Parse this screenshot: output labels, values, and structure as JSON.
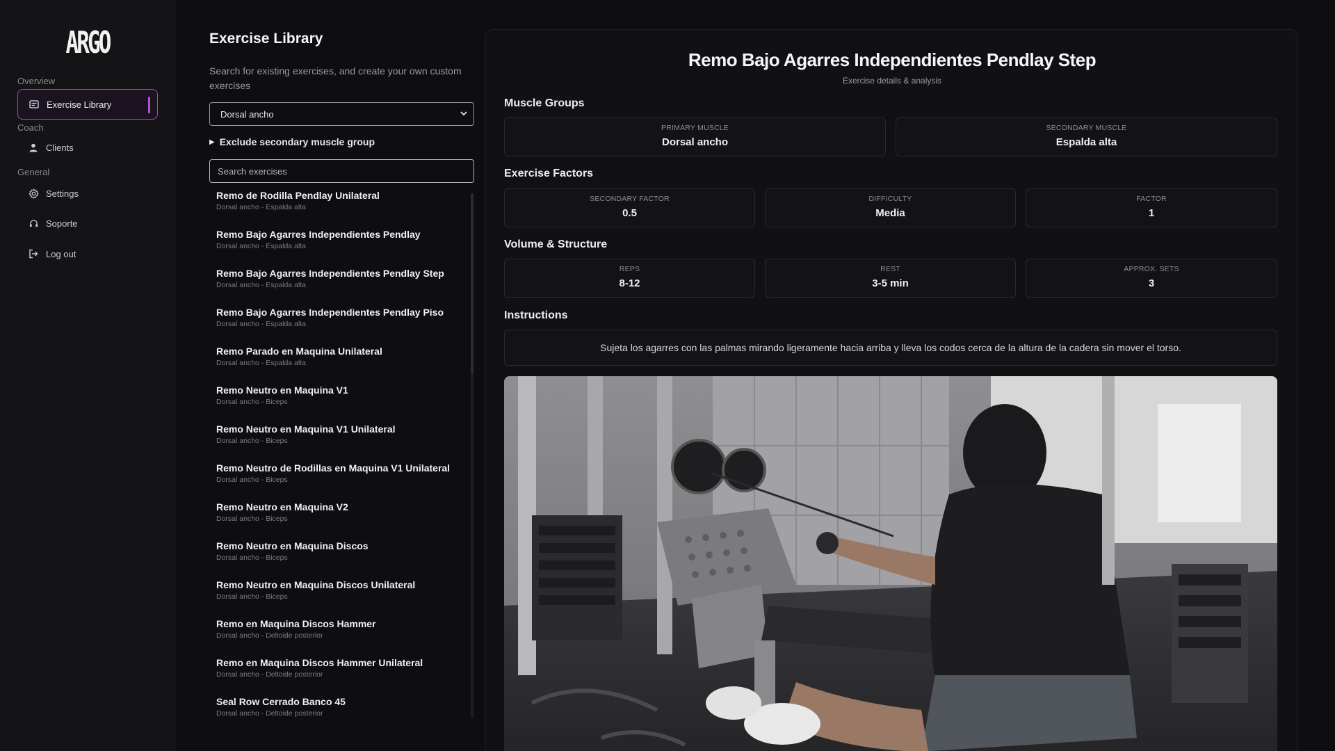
{
  "app": {
    "logo_text": "ARGO"
  },
  "sidebar": {
    "sections": [
      {
        "label": "Overview"
      },
      {
        "label": "Coach"
      },
      {
        "label": "General"
      }
    ],
    "items": [
      {
        "label": "Exercise Library",
        "icon": "library-icon"
      },
      {
        "label": "Clients",
        "icon": "user-icon"
      },
      {
        "label": "Settings",
        "icon": "gear-icon"
      },
      {
        "label": "Soporte",
        "icon": "support-icon"
      },
      {
        "label": "Log out",
        "icon": "logout-icon"
      }
    ]
  },
  "library": {
    "title": "Exercise Library",
    "description": "Search for existing exercises, and create your own custom exercises",
    "muscle_select": {
      "value": "Dorsal ancho"
    },
    "exclude_toggle": "Exclude secondary muscle group",
    "search": {
      "placeholder": "Search exercises",
      "value": ""
    },
    "exercises": [
      {
        "name": "Remo de Rodilla Pendlay Unilateral",
        "muscles": "Dorsal ancho - Espalda alta"
      },
      {
        "name": "Remo Bajo Agarres Independientes Pendlay",
        "muscles": "Dorsal ancho - Espalda alta"
      },
      {
        "name": "Remo Bajo Agarres Independientes Pendlay Step",
        "muscles": "Dorsal ancho - Espalda alta"
      },
      {
        "name": "Remo Bajo Agarres Independientes Pendlay Piso",
        "muscles": "Dorsal ancho - Espalda alta"
      },
      {
        "name": "Remo Parado en Maquina Unilateral",
        "muscles": "Dorsal ancho - Espalda alta"
      },
      {
        "name": "Remo Neutro en Maquina V1",
        "muscles": "Dorsal ancho - Biceps"
      },
      {
        "name": "Remo Neutro en Maquina V1 Unilateral",
        "muscles": "Dorsal ancho - Biceps"
      },
      {
        "name": "Remo Neutro de Rodillas en Maquina V1 Unilateral",
        "muscles": "Dorsal ancho - Biceps"
      },
      {
        "name": "Remo Neutro en Maquina V2",
        "muscles": "Dorsal ancho - Biceps"
      },
      {
        "name": "Remo Neutro en Maquina Discos",
        "muscles": "Dorsal ancho - Biceps"
      },
      {
        "name": "Remo Neutro en Maquina Discos Unilateral",
        "muscles": "Dorsal ancho - Biceps"
      },
      {
        "name": "Remo en Maquina Discos Hammer",
        "muscles": "Dorsal ancho - Deltoide posterior"
      },
      {
        "name": "Remo en Maquina Discos Hammer Unilateral",
        "muscles": "Dorsal ancho - Deltoide posterior"
      },
      {
        "name": "Seal Row Cerrado Banco 45",
        "muscles": "Dorsal ancho - Deltoide posterior"
      }
    ]
  },
  "detail": {
    "title": "Remo Bajo Agarres Independientes Pendlay Step",
    "subtitle": "Exercise details & analysis",
    "muscle_groups": {
      "heading": "Muscle Groups",
      "primary": {
        "label": "Primary Muscle",
        "value": "Dorsal ancho"
      },
      "secondary": {
        "label": "Secondary Muscle",
        "value": "Espalda alta"
      }
    },
    "factors": {
      "heading": "Exercise Factors",
      "secondary_factor": {
        "label": "Secondary Factor",
        "value": "0.5"
      },
      "difficulty": {
        "label": "Difficulty",
        "value": "Media"
      },
      "factor": {
        "label": "Factor",
        "value": "1"
      }
    },
    "volume": {
      "heading": "Volume & Structure",
      "reps": {
        "label": "Reps",
        "value": "8-12"
      },
      "rest": {
        "label": "Rest",
        "value": "3-5 min"
      },
      "sets": {
        "label": "Approx. Sets",
        "value": "3"
      }
    },
    "instructions": {
      "heading": "Instructions",
      "text": "Sujeta los agarres con las palmas mirando ligeramente hacia arriba y lleva los codos cerca de la altura de la cadera sin mover el torso."
    }
  },
  "colors": {
    "accent": "#c44ad9",
    "background": "#0e0e10",
    "card": "#131316"
  }
}
